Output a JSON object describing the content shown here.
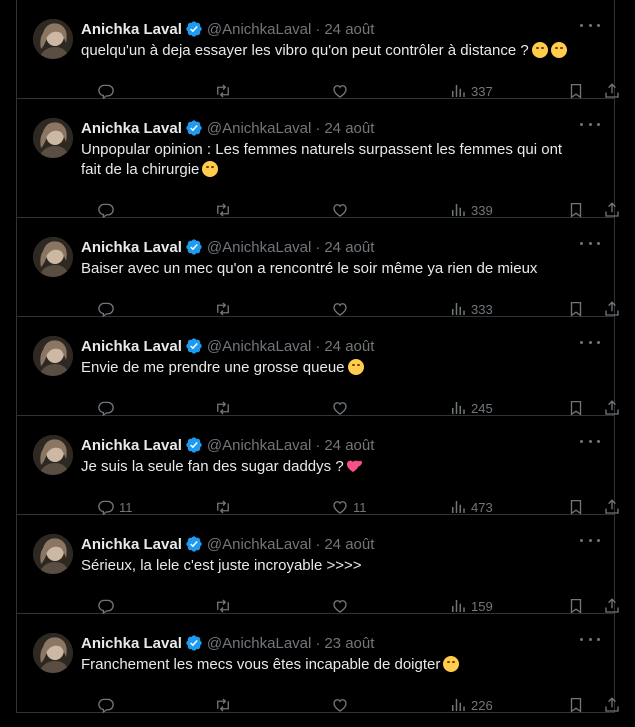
{
  "tweets": [
    {
      "name": "Anichka Laval",
      "handle": "@AnichkaLaval",
      "date": "24 août",
      "text": "quelqu'un à deja essayer les vibro qu'on peut contrôler à distance ?",
      "emojis": [
        "hugging-face-emoji",
        "face-with-hand-over-mouth-emoji"
      ],
      "replies": "",
      "reposts": "",
      "likes": "",
      "views": "337"
    },
    {
      "name": "Anichka Laval",
      "handle": "@AnichkaLaval",
      "date": "24 août",
      "text": "Unpopular opinion : Les femmes naturels surpassent les femmes qui ont fait de la chirurgie",
      "emojis": [
        "relieved-face-emoji"
      ],
      "replies": "",
      "reposts": "",
      "likes": "",
      "views": "339"
    },
    {
      "name": "Anichka Laval",
      "handle": "@AnichkaLaval",
      "date": "24 août",
      "text": "Baiser avec un mec qu'on a rencontré le soir même ya rien de mieux",
      "emojis": [],
      "replies": "",
      "reposts": "",
      "likes": "",
      "views": "333"
    },
    {
      "name": "Anichka Laval",
      "handle": "@AnichkaLaval",
      "date": "24 août",
      "text": "Envie de me prendre une grosse queue",
      "emojis": [
        "flushed-face-emoji"
      ],
      "replies": "",
      "reposts": "",
      "likes": "",
      "views": "245"
    },
    {
      "name": "Anichka Laval",
      "handle": "@AnichkaLaval",
      "date": "24 août",
      "text": "Je suis la seule fan des sugar daddys ?",
      "emojis": [
        "two-hearts-emoji"
      ],
      "replies": "11",
      "reposts": "",
      "likes": "11",
      "views": "473"
    },
    {
      "name": "Anichka Laval",
      "handle": "@AnichkaLaval",
      "date": "24 août",
      "text": "Sérieux, la lele c'est juste incroyable >>>>",
      "emojis": [],
      "replies": "",
      "reposts": "",
      "likes": "",
      "views": "159"
    },
    {
      "name": "Anichka Laval",
      "handle": "@AnichkaLaval",
      "date": "23 août",
      "text": "Franchement les mecs vous êtes incapable de doigter",
      "emojis": [
        "relieved-face-emoji"
      ],
      "replies": "",
      "reposts": "",
      "likes": "",
      "views": "226"
    }
  ],
  "icons": {
    "verified": "verified-badge-icon",
    "more": "more-dots-icon",
    "reply": "reply-icon",
    "repost": "repost-icon",
    "like": "like-icon",
    "views": "views-icon",
    "bookmark": "bookmark-icon",
    "share": "share-icon"
  },
  "colors": {
    "background": "#000000",
    "text": "#e7e9ea",
    "muted": "#71767b",
    "border": "#2f3336",
    "verified": "#1d9bf0"
  }
}
